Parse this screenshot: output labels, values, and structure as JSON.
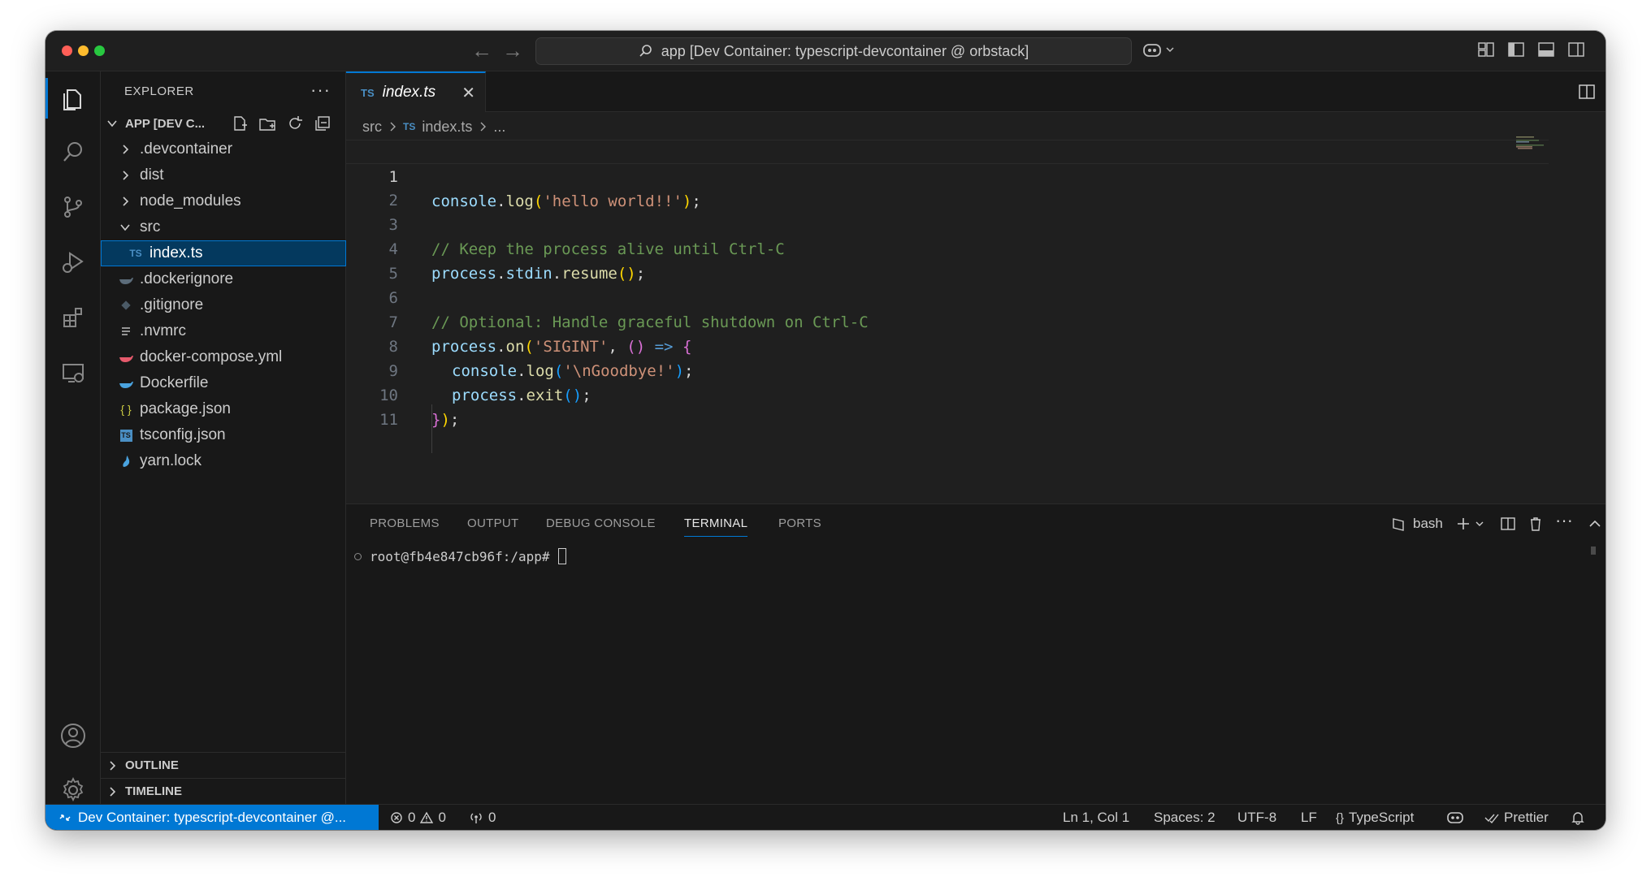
{
  "titlebar": {
    "command_center": "app [Dev Container: typescript-devcontainer @ orbstack]"
  },
  "sidebar": {
    "title": "EXPLORER",
    "folder_label": "APP [DEV C...",
    "tree": [
      {
        "label": ".devcontainer",
        "kind": "folder",
        "expanded": false
      },
      {
        "label": "dist",
        "kind": "folder",
        "expanded": false
      },
      {
        "label": "node_modules",
        "kind": "folder",
        "expanded": false
      },
      {
        "label": "src",
        "kind": "folder",
        "expanded": true
      },
      {
        "label": "index.ts",
        "kind": "file",
        "icon": "TS",
        "selected": true
      },
      {
        "label": ".dockerignore",
        "kind": "file",
        "icon": "docker-icon"
      },
      {
        "label": ".gitignore",
        "kind": "file",
        "icon": "git-icon"
      },
      {
        "label": ".nvmrc",
        "kind": "file",
        "icon": "lines-icon"
      },
      {
        "label": "docker-compose.yml",
        "kind": "file",
        "icon": "docker-compose-icon"
      },
      {
        "label": "Dockerfile",
        "kind": "file",
        "icon": "docker-icon"
      },
      {
        "label": "package.json",
        "kind": "file",
        "icon": "{ }"
      },
      {
        "label": "tsconfig.json",
        "kind": "file",
        "icon": "TS"
      },
      {
        "label": "yarn.lock",
        "kind": "file",
        "icon": "yarn-icon"
      }
    ],
    "sections": [
      "OUTLINE",
      "TIMELINE"
    ]
  },
  "editor": {
    "tab_badge": "TS",
    "tab_label": "index.ts",
    "breadcrumb": {
      "folder": "src",
      "badge": "TS",
      "file": "index.ts",
      "more": "..."
    },
    "lines": [
      {
        "num": "1"
      },
      {
        "num": "2"
      },
      {
        "num": "3"
      },
      {
        "num": "4"
      },
      {
        "num": "5"
      },
      {
        "num": "6"
      },
      {
        "num": "7"
      },
      {
        "num": "8"
      },
      {
        "num": "9"
      },
      {
        "num": "10"
      },
      {
        "num": "11"
      }
    ],
    "code": {
      "l1_obj": "console",
      "l1_dot": ".",
      "l1_fn": "log",
      "l1_open": "(",
      "l1_str": "'hello world!!'",
      "l1_close": ")",
      "l1_end": ";",
      "l3_comment": "// Keep the process alive until Ctrl-C",
      "l4_obj": "process",
      "l4_dot": ".",
      "l4_prop": "stdin",
      "l4_dot2": ".",
      "l4_fn": "resume",
      "l4_parens": "()",
      "l4_end": ";",
      "l6_comment": "// Optional: Handle graceful shutdown on Ctrl-C",
      "l7_obj": "process",
      "l7_dot": ".",
      "l7_fn": "on",
      "l7_open": "(",
      "l7_str": "'SIGINT'",
      "l7_comma": ", ",
      "l7_params": "()",
      "l7_arrow": " => ",
      "l7_brace": "{",
      "l8_obj": "console",
      "l8_dot": ".",
      "l8_fn": "log",
      "l8_open": "(",
      "l8_str": "'\\nGoodbye!'",
      "l8_close": ")",
      "l8_end": ";",
      "l9_obj": "process",
      "l9_dot": ".",
      "l9_fn": "exit",
      "l9_parens": "()",
      "l9_end": ";",
      "l10_brace": "}",
      "l10_paren": ")",
      "l10_end": ";"
    }
  },
  "panel": {
    "tabs": [
      "PROBLEMS",
      "OUTPUT",
      "DEBUG CONSOLE",
      "TERMINAL",
      "PORTS"
    ],
    "active_tab": "TERMINAL",
    "shell": "bash",
    "terminal_prompt": "root@fb4e847cb96f:/app#"
  },
  "statusbar": {
    "remote": "Dev Container: typescript-devcontainer @...",
    "errors": "0",
    "warnings": "0",
    "ports": "0",
    "cursor_pos": "Ln 1, Col 1",
    "indent": "Spaces: 2",
    "encoding": "UTF-8",
    "eol": "LF",
    "language": "TypeScript",
    "formatter": "Prettier"
  },
  "colors": {
    "accent": "#0078d4",
    "background": "#1f1f1f",
    "sidebar": "#181818",
    "comment": "#6a9955",
    "string": "#ce9178"
  }
}
